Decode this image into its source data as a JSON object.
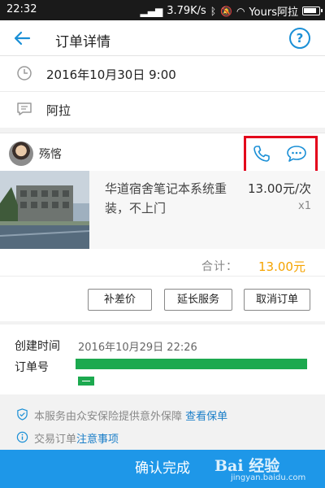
{
  "status_bar": {
    "time": "22:32",
    "network_speed": "3.79K/s",
    "carrier": "Yours阿拉"
  },
  "header": {
    "title": "订单详情",
    "help_label": "?"
  },
  "info": {
    "datetime": "2016年10月30日 9:00",
    "note": "阿拉"
  },
  "provider": {
    "name": "殇愘"
  },
  "product": {
    "name": "华道宿舍笔记本系统重装，不上门",
    "price": "13.00元/次",
    "quantity": "x1"
  },
  "total": {
    "label": "合计：",
    "value": "13.00元"
  },
  "actions": {
    "price_diff": "补差价",
    "extend_service": "延长服务",
    "cancel_order": "取消订单"
  },
  "order_meta": {
    "created_label": "创建时间",
    "created_value": "2016年10月29日 22:26",
    "order_no_label": "订单号"
  },
  "notices": {
    "insurance_text": "本服务由众安保险提供意外保障",
    "insurance_link": "查看保单",
    "trade_text": "交易订单",
    "trade_link": "注意事项"
  },
  "confirm_label": "确认完成",
  "watermark": {
    "main": "Bai 经验",
    "sub": "jingyan.baidu.com"
  },
  "colors": {
    "accent": "#1e97e8",
    "price": "#f5a300",
    "highlight": "#e3001b",
    "redaction": "#1ca94f"
  }
}
